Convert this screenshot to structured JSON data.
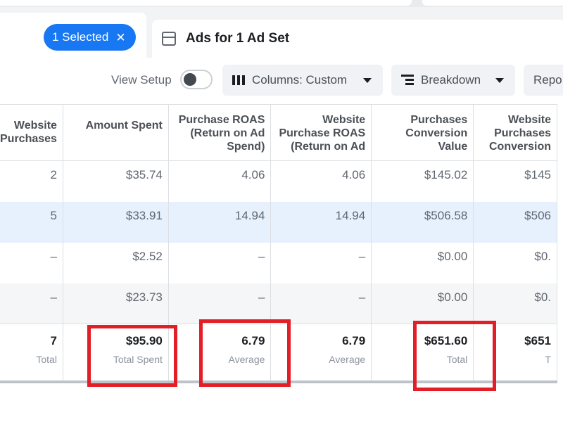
{
  "tabs": {
    "selected_label": "1 Selected",
    "selected_close": "✕",
    "ads_label": "Ads for 1 Ad Set"
  },
  "toolbar": {
    "view_setup_label": "View Setup",
    "columns_label": "Columns: Custom",
    "breakdown_label": "Breakdown",
    "reports_label": "Repo"
  },
  "table": {
    "headers": [
      "Website\nPurchases",
      "Amount Spent",
      "Purchase ROAS\n(Return on Ad\nSpend)",
      "Website\nPurchase ROAS\n(Return on Ad",
      "Purchases\nConversion\nValue",
      "Website\nPurchases\nConversion"
    ],
    "rows": [
      [
        "2",
        "$35.74",
        "4.06",
        "4.06",
        "$145.02",
        "$145"
      ],
      [
        "5",
        "$33.91",
        "14.94",
        "14.94",
        "$506.58",
        "$506"
      ],
      [
        "–",
        "$2.52",
        "–",
        "–",
        "$0.00",
        "$0."
      ],
      [
        "–",
        "$23.73",
        "–",
        "–",
        "$0.00",
        "$0."
      ]
    ],
    "totals": [
      {
        "value": "7",
        "label": "Total"
      },
      {
        "value": "$95.90",
        "label": "Total Spent"
      },
      {
        "value": "6.79",
        "label": "Average"
      },
      {
        "value": "6.79",
        "label": "Average"
      },
      {
        "value": "$651.60",
        "label": "Total"
      },
      {
        "value": "$651",
        "label": "T"
      }
    ]
  },
  "colors": {
    "accent": "#1877f2",
    "highlight": "#e41e26",
    "selected_row": "#e7f0fd"
  }
}
